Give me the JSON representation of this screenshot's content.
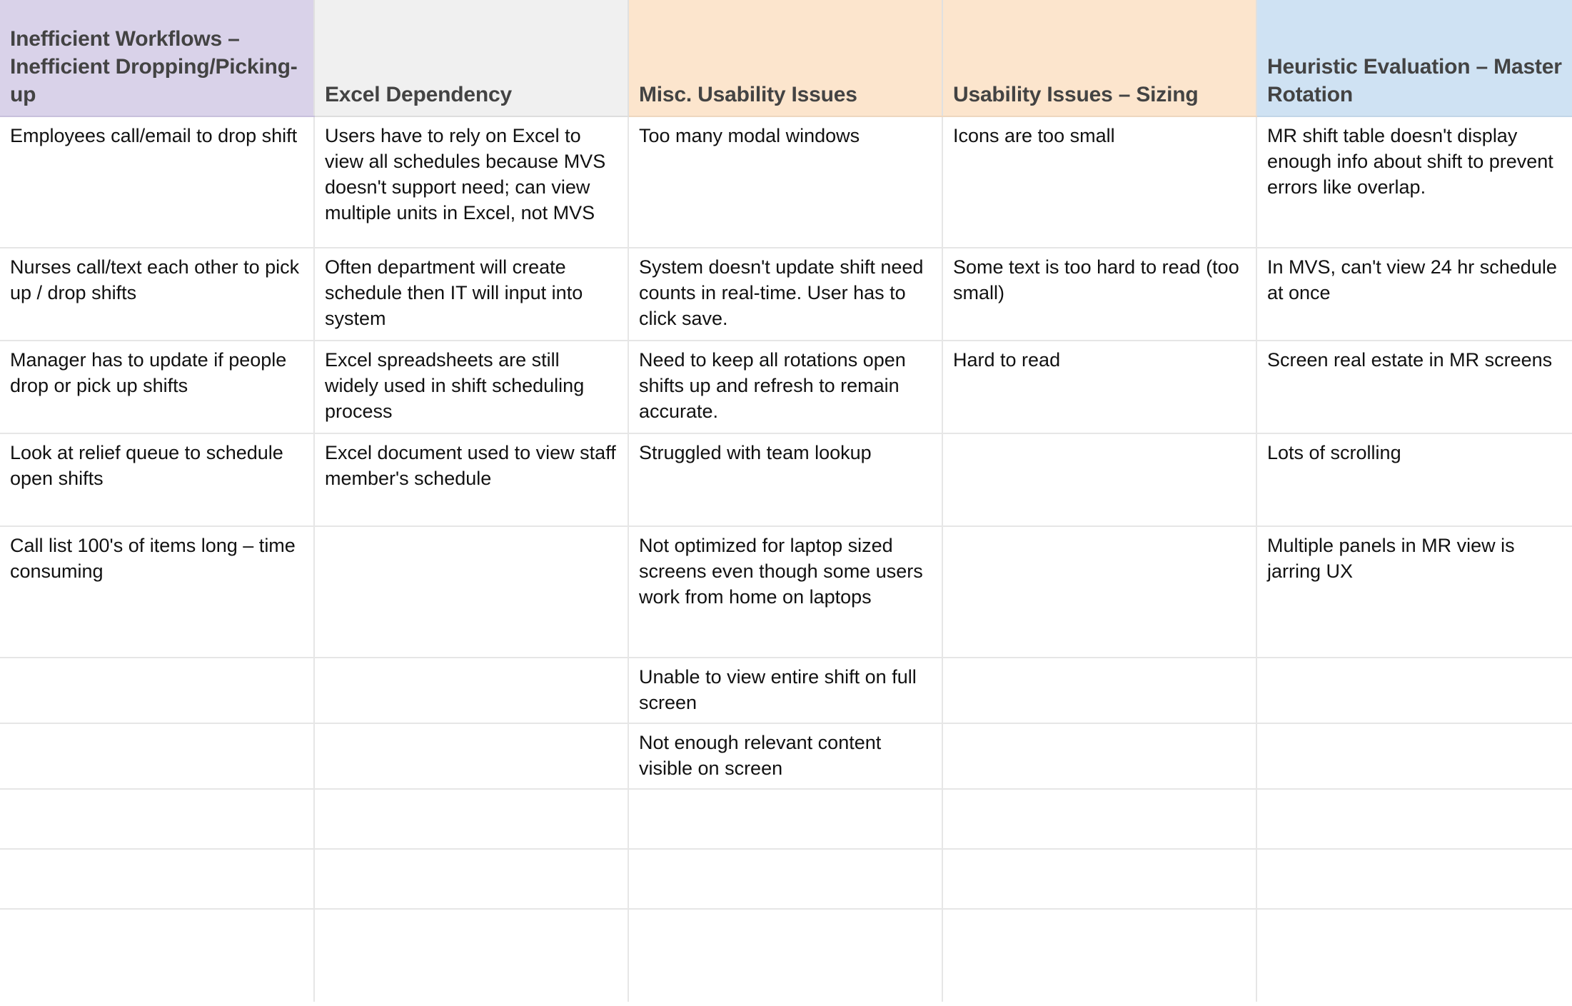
{
  "table": {
    "type": "table",
    "column_count": 5,
    "row_count": 10,
    "header_colors": [
      "#d9d2e9",
      "#f0f0f0",
      "#fce5cd",
      "#fce5cd",
      "#cfe2f3"
    ],
    "header_text_color": "#434343",
    "body_text_color": "#111111",
    "grid_line_color": "#e6e6e6",
    "headers": [
      "Inefficient Workflows – Inefficient Dropping/Picking-up",
      "Excel Dependency",
      "Misc. Usability Issues",
      "Usability Issues – Sizing",
      "Heuristic Evaluation – Master Rotation"
    ],
    "rows": [
      [
        "Employees call/email to drop shift",
        "Users have to rely on Excel to view all schedules because MVS doesn't support need; can view multiple units in Excel, not MVS",
        "Too many modal windows",
        "Icons are too small",
        "MR shift table doesn't display enough info about shift to prevent errors like overlap."
      ],
      [
        "Nurses call/text each other to pick up / drop shifts",
        "Often department will create schedule then IT will input into system",
        "System doesn't update shift need counts in real-time. User has to click save.",
        "Some text is too hard to read (too small)",
        "In MVS, can't view 24 hr schedule at once"
      ],
      [
        "Manager has to update if people drop or pick up shifts",
        "Excel spreadsheets are still widely used in shift scheduling process",
        "Need to keep all rotations open shifts up and refresh to remain accurate.",
        "Hard to read",
        "Screen real estate in MR screens"
      ],
      [
        "Look at relief queue to schedule open shifts",
        "Excel document used to view staff member's schedule",
        "Struggled with team lookup",
        "",
        "Lots of scrolling"
      ],
      [
        "Call list 100's of items long – time consuming",
        "",
        "Not optimized for laptop sized screens even though some users work from home on laptops",
        "",
        "Multiple panels in MR view is jarring UX"
      ],
      [
        "",
        "",
        "Unable to view entire shift on full screen",
        "",
        ""
      ],
      [
        "",
        "",
        "Not enough relevant content visible on screen",
        "",
        ""
      ],
      [
        "",
        "",
        "",
        "",
        ""
      ],
      [
        "",
        "",
        "",
        "",
        ""
      ],
      [
        "",
        "",
        "",
        "",
        ""
      ]
    ]
  }
}
